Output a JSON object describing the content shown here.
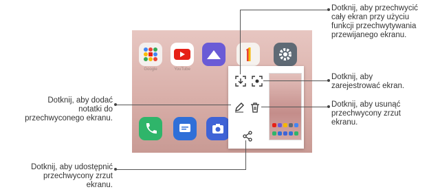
{
  "callouts": {
    "scroll_capture": {
      "line1": "Dotknij, aby przechwycić",
      "line2": "cały ekran przy użyciu",
      "line3": "funkcji przechwytywania",
      "line4": "przewijanego ekranu."
    },
    "record": {
      "line1": "Dotknij, aby",
      "line2": "zarejestrować ekran."
    },
    "delete": {
      "line1": "Dotknij, aby usunąć",
      "line2": "przechwycony zrzut",
      "line3": "ekranu."
    },
    "notes": {
      "line1": "Dotknij, aby dodać",
      "line2": "notatki do",
      "line3": "przechwyconego ekranu."
    },
    "share": {
      "line1": "Dotknij, aby udostępnić",
      "line2": "przechwycony zrzut",
      "line3": "ekranu."
    }
  },
  "home_screen": {
    "app_labels": {
      "google": "Google",
      "youtube": "YouTube",
      "gallery": "",
      "one": "",
      "settings": ""
    }
  },
  "icons": {
    "scroll_capture": "scroll-capture-icon",
    "record": "screen-record-icon",
    "edit": "pencil-icon",
    "delete": "trash-icon",
    "share": "share-icon"
  },
  "colors": {
    "youtube": "#e62117",
    "gallery": "#6a5bd6",
    "settings": "#5f6a75",
    "phone": "#2fb56a",
    "messages": "#2f6fd8",
    "camera": "#3f63d6",
    "one_yellow": "#f5b700",
    "one_red": "#e84236"
  }
}
